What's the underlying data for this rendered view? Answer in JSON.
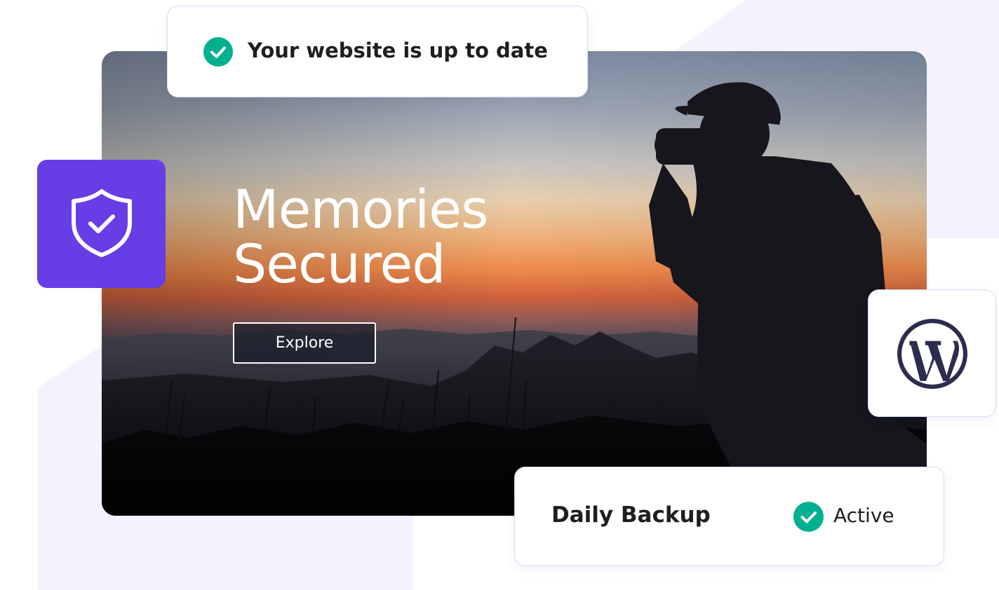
{
  "status_card": {
    "text": "Your website is up to date",
    "icon": "check-circle-icon"
  },
  "hero": {
    "title_line1": "Memories",
    "title_line2": "Secured",
    "cta_label": "Explore",
    "image": "photographer-at-sunset-photo"
  },
  "security_badge": {
    "icon": "shield-check-icon"
  },
  "wordpress_badge": {
    "icon": "wordpress-logo-icon"
  },
  "backup_card": {
    "title": "Daily Backup",
    "status": "Active",
    "status_icon": "check-circle-icon"
  },
  "colors": {
    "accent_purple": "#673de6",
    "success_green": "#00b090",
    "text_dark": "#1d1e20",
    "card_border": "#d6dcf5",
    "wordpress_navy": "#2c2c4e"
  }
}
